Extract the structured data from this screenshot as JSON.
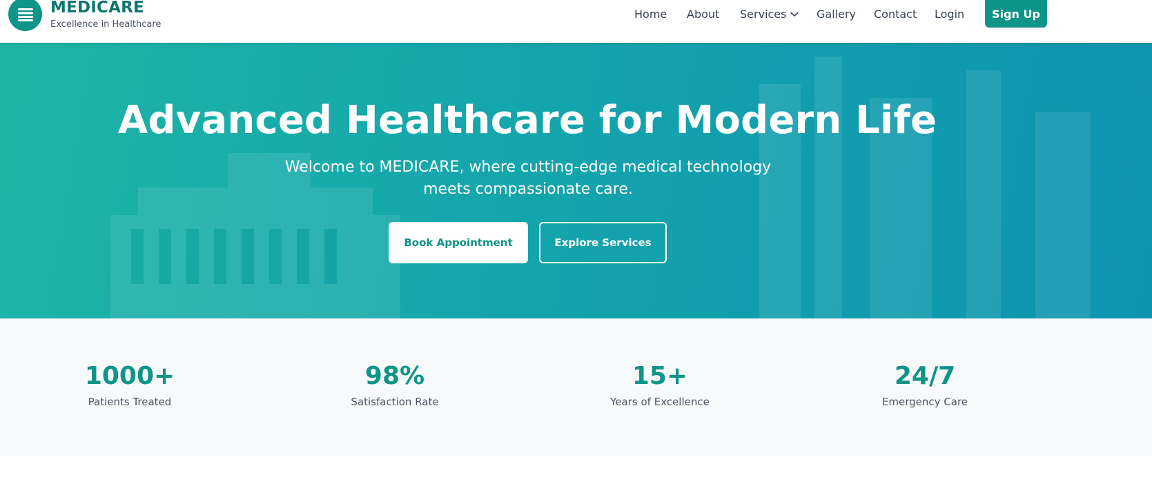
{
  "brand": {
    "name": "MEDICARE",
    "tagline": "Excellence in Healthcare"
  },
  "nav": {
    "home": "Home",
    "about": "About",
    "services": "Services",
    "gallery": "Gallery",
    "contact": "Contact",
    "login": "Login",
    "signup": "Sign Up"
  },
  "hero": {
    "title": "Advanced Healthcare for Modern Life",
    "subtitle": "Welcome to MEDICARE, where cutting-edge medical technology meets compassionate care.",
    "primary_cta": "Book Appointment",
    "secondary_cta": "Explore Services"
  },
  "stats": [
    {
      "value": "1000+",
      "label": "Patients Treated"
    },
    {
      "value": "98%",
      "label": "Satisfaction Rate"
    },
    {
      "value": "15+",
      "label": "Years of Excellence"
    },
    {
      "value": "24/7",
      "label": "Emergency Care"
    }
  ],
  "icons": {
    "menu": "menu-icon",
    "chevron": "chevron-down-icon"
  },
  "colors": {
    "brand": "#0f9488",
    "brand_dark": "#0f766e",
    "hero_start": "#1db5a5",
    "hero_end": "#0d93b0"
  }
}
